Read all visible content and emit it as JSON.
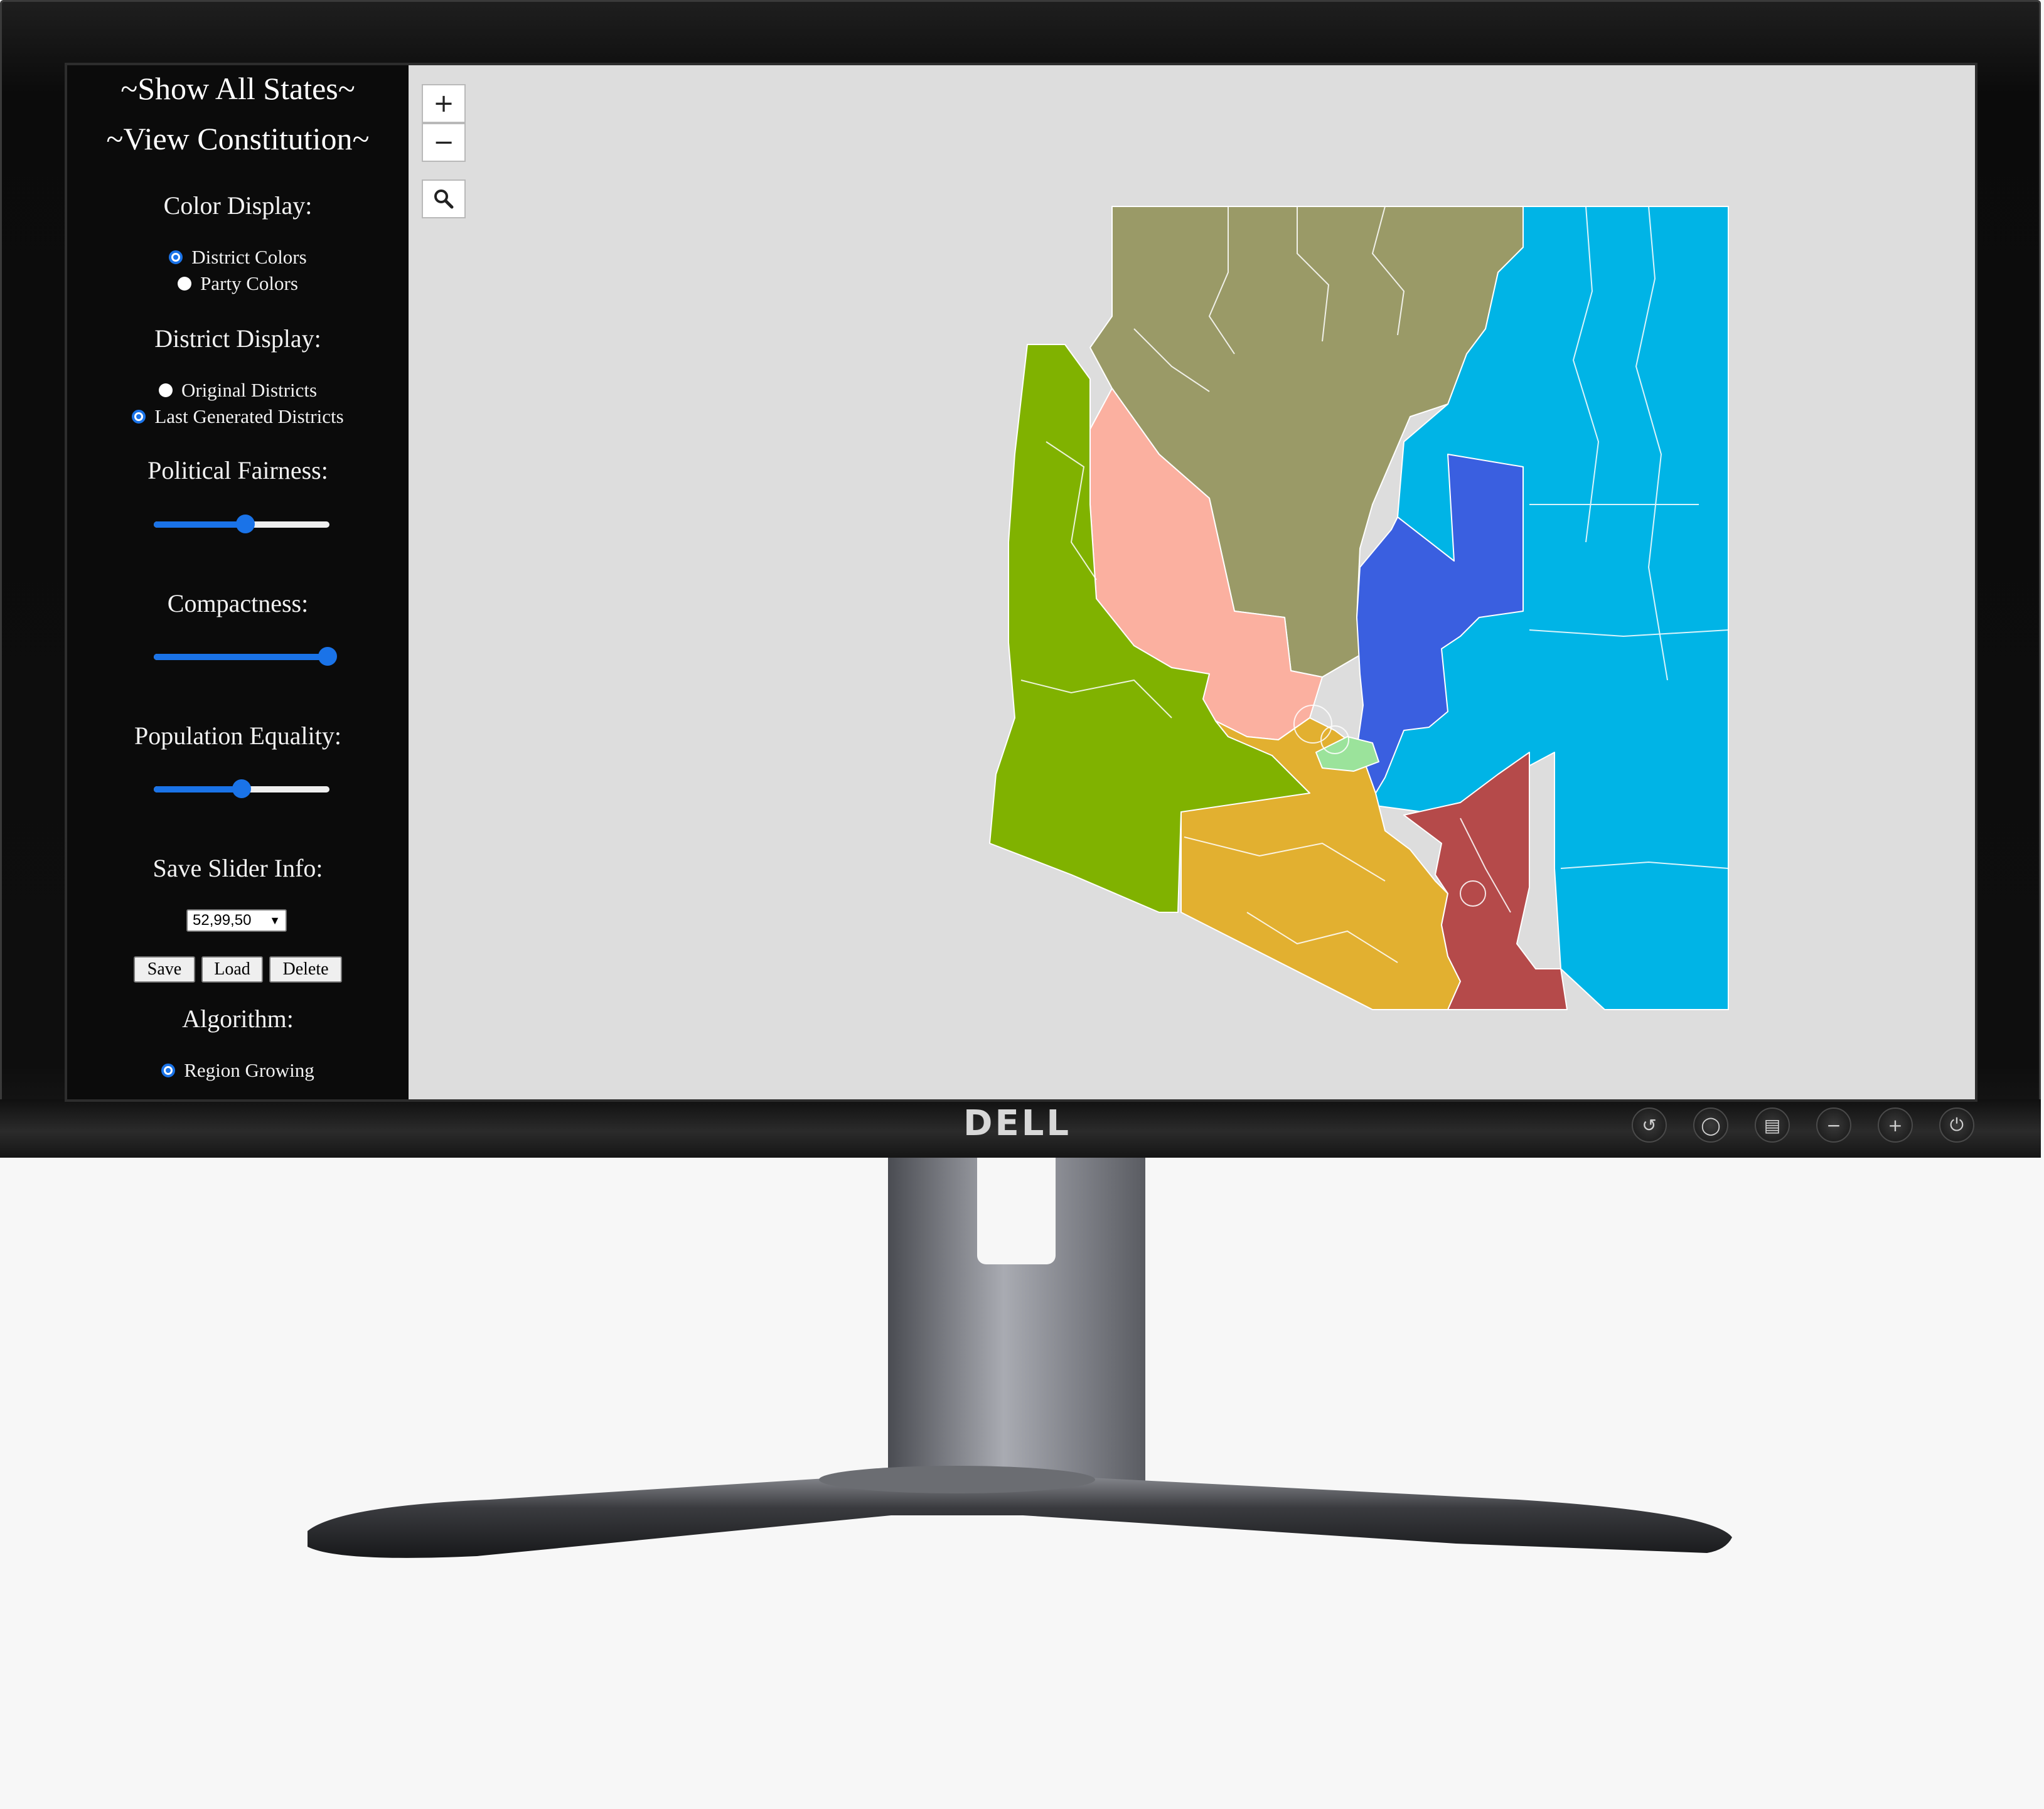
{
  "sidebar": {
    "nav": [
      "~Show All States~",
      "~View Constitution~"
    ],
    "color_display": {
      "title": "Color Display:",
      "options": [
        "District Colors",
        "Party Colors"
      ],
      "selected": "District Colors"
    },
    "district_display": {
      "title": "District Display:",
      "options": [
        "Original Districts",
        "Last Generated Districts"
      ],
      "selected": "Last Generated Districts"
    },
    "political_fairness": {
      "title": "Political Fairness:",
      "value": 0.52
    },
    "compactness": {
      "title": "Compactness:",
      "value": 0.99
    },
    "population_equality": {
      "title": "Population Equality:",
      "value": 0.5
    },
    "save_slider": {
      "title": "Save Slider Info:",
      "selected": "52,99,50",
      "buttons": [
        "Save",
        "Load",
        "Delete"
      ]
    },
    "algorithm": {
      "title": "Algorithm:",
      "options": [
        "Region Growing"
      ],
      "selected": "Region Growing"
    }
  },
  "map_controls": {
    "zoom_in": "+",
    "zoom_out": "−",
    "search_icon": "search-icon"
  },
  "districts": [
    {
      "name": "district-olive",
      "color": "#9a9a67"
    },
    {
      "name": "district-cyan",
      "color": "#00b4e6"
    },
    {
      "name": "district-green",
      "color": "#80b200"
    },
    {
      "name": "district-salmon",
      "color": "#fbb0a0"
    },
    {
      "name": "district-blue",
      "color": "#3a5fe0"
    },
    {
      "name": "district-gold",
      "color": "#e2b030"
    },
    {
      "name": "district-red",
      "color": "#b54a4a"
    },
    {
      "name": "district-lightgreen",
      "color": "#9be39b"
    }
  ],
  "monitor": {
    "brand": "DELL"
  }
}
